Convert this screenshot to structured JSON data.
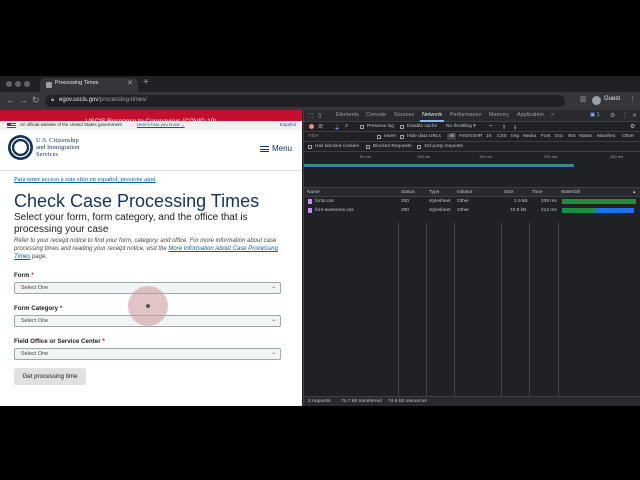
{
  "browser": {
    "tab_title": "Processing Times",
    "tab_close": "✕",
    "new_tab": "+",
    "url_host": "egov.uscis.gov",
    "url_path": "/processing-times/",
    "profile_label": "Guest"
  },
  "page": {
    "covid_banner": "USCIS Response to Coronavirus (COVID-19)",
    "gov_banner_text": "An official website of the United States government",
    "gov_banner_link": "Here's how you know",
    "language_link": "Español",
    "agency_line1": "U.S. Citizenship",
    "agency_line2": "and Immigration",
    "agency_line3": "Services",
    "menu_label": "Menu",
    "spanish_link": "Para tener acceso a este sitio en español, presione aquí",
    "title": "Check Case Processing Times",
    "subtitle": "Select your form, form category, and the office that is processing your case",
    "intro_text": "Refer to your receipt notice to find your form, category, and office. For more information about case processing times and reading your receipt notice, visit the",
    "intro_link": "More Information About Case Processing Times",
    "intro_end": "page.",
    "fields": [
      {
        "label": "Form",
        "required": "*",
        "value": "Select One"
      },
      {
        "label": "Form Category",
        "required": "*",
        "value": "Select One"
      },
      {
        "label": "Field Office or Service Center",
        "required": "*",
        "value": "Select One"
      }
    ],
    "submit_label": "Get processing time"
  },
  "devtools": {
    "tabs": [
      "Elements",
      "Console",
      "Sources",
      "Network",
      "Performance",
      "Memory",
      "Application",
      "»"
    ],
    "active_tab": "Network",
    "badge": "1",
    "toolbar": {
      "preserve_log": "Preserve log",
      "disable_cache": "Disable cache",
      "throttling": "No throttling"
    },
    "filter": {
      "placeholder": "Filter",
      "invert": "Invert",
      "hide_data_urls": "Hide data URLs",
      "types": [
        "All",
        "Fetch/XHR",
        "JS",
        "CSS",
        "Img",
        "Media",
        "Font",
        "Doc",
        "WS",
        "Wasm",
        "Manifest",
        "Other"
      ],
      "blocked_cookies": "Has blocked cookies",
      "blocked_requests": "Blocked Requests",
      "third_party": "3rd-party requests"
    },
    "overview_ticks": [
      "50 ms",
      "100 ms",
      "150 ms",
      "200 ms",
      "250 ms"
    ],
    "columns": [
      "Name",
      "Status",
      "Type",
      "Initiator",
      "Size",
      "Time",
      "Waterfall"
    ],
    "requests": [
      {
        "name": "fonts.css",
        "status": "200",
        "type": "stylesheet",
        "initiator": "Other",
        "size": "1.9 kB",
        "time": "239 ms"
      },
      {
        "name": "font-awesome.css",
        "status": "200",
        "type": "stylesheet",
        "initiator": "Other",
        "size": "72.8 kB",
        "time": "212 ms"
      }
    ],
    "status_bar": {
      "requests": "2 requests",
      "transferred": "74.7 kB transferred",
      "resources": "74.6 kB resources"
    }
  }
}
